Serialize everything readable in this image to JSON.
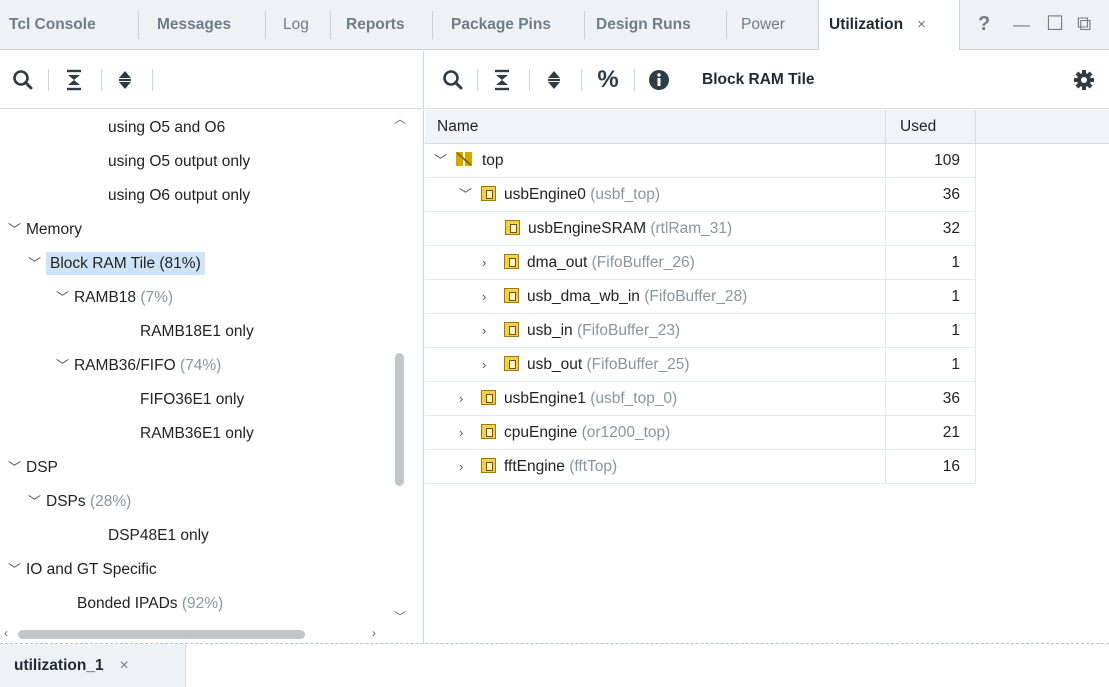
{
  "tabs": [
    {
      "label": "Tcl Console",
      "bold": true
    },
    {
      "label": "Messages",
      "bold": true
    },
    {
      "label": "Log",
      "bold": false
    },
    {
      "label": "Reports",
      "bold": true
    },
    {
      "label": "Package Pins",
      "bold": true
    },
    {
      "label": "Design Runs",
      "bold": true
    },
    {
      "label": "Power",
      "bold": false
    },
    {
      "label": "Utilization",
      "bold": true,
      "active": true
    }
  ],
  "window_controls": {
    "help": "?",
    "minimize": "—",
    "maximize": "☐",
    "restore": "⧉",
    "tab_close": "×"
  },
  "left_toolbar": {
    "icons": [
      "search-icon",
      "collapse-all-icon",
      "expand-all-icon"
    ]
  },
  "right_toolbar": {
    "icons": [
      "search-icon",
      "collapse-all-icon",
      "expand-all-icon",
      "percent-icon",
      "info-icon",
      "gear-icon"
    ],
    "title": "Block RAM Tile",
    "percent": "%"
  },
  "left_tree": [
    {
      "label": "using O5 and O6",
      "pct": "",
      "expand": ""
    },
    {
      "label": "using O5 output only",
      "pct": "",
      "expand": ""
    },
    {
      "label": "using O6 output only",
      "pct": "",
      "expand": ""
    },
    {
      "label": "Memory",
      "pct": "",
      "expand": "expanded"
    },
    {
      "label": "Block RAM Tile (81%)",
      "pct": "",
      "expand": "expanded",
      "selected": true
    },
    {
      "label": "RAMB18",
      "pct": "(7%)",
      "expand": "expanded"
    },
    {
      "label": "RAMB18E1 only",
      "pct": "",
      "expand": ""
    },
    {
      "label": "RAMB36/FIFO",
      "pct": "(74%)",
      "expand": "expanded"
    },
    {
      "label": "FIFO36E1 only",
      "pct": "",
      "expand": ""
    },
    {
      "label": "RAMB36E1 only",
      "pct": "",
      "expand": ""
    },
    {
      "label": "DSP",
      "pct": "",
      "expand": "expanded"
    },
    {
      "label": "DSPs",
      "pct": "(28%)",
      "expand": "expanded"
    },
    {
      "label": "DSP48E1 only",
      "pct": "",
      "expand": ""
    },
    {
      "label": "IO and GT Specific",
      "pct": "",
      "expand": "expanded"
    },
    {
      "label": "Bonded IPADs",
      "pct": "(92%)",
      "expand": ""
    }
  ],
  "table": {
    "columns": [
      "Name",
      "Used"
    ],
    "rows": [
      {
        "name": "top",
        "sub": "",
        "used": "109",
        "expand": "expanded"
      },
      {
        "name": "usbEngine0",
        "sub": "(usbf_top)",
        "used": "36",
        "expand": "expanded"
      },
      {
        "name": "usbEngineSRAM",
        "sub": "(rtlRam_31)",
        "used": "32",
        "expand": ""
      },
      {
        "name": "dma_out",
        "sub": "(FifoBuffer_26)",
        "used": "1",
        "expand": "collapsed"
      },
      {
        "name": "usb_dma_wb_in",
        "sub": "(FifoBuffer_28)",
        "used": "1",
        "expand": "collapsed"
      },
      {
        "name": "usb_in",
        "sub": "(FifoBuffer_23)",
        "used": "1",
        "expand": "collapsed"
      },
      {
        "name": "usb_out",
        "sub": "(FifoBuffer_25)",
        "used": "1",
        "expand": "collapsed"
      },
      {
        "name": "usbEngine1",
        "sub": "(usbf_top_0)",
        "used": "36",
        "expand": "collapsed"
      },
      {
        "name": "cpuEngine",
        "sub": "(or1200_top)",
        "used": "21",
        "expand": "collapsed"
      },
      {
        "name": "fftEngine",
        "sub": "(fftTop)",
        "used": "16",
        "expand": "collapsed"
      }
    ]
  },
  "bottom_tab": {
    "label": "utilization_1",
    "close": "×"
  },
  "colors": {
    "selection": "#cfe3f7",
    "header_bg": "#eef2f5",
    "module_icon": "#f5cf45"
  }
}
